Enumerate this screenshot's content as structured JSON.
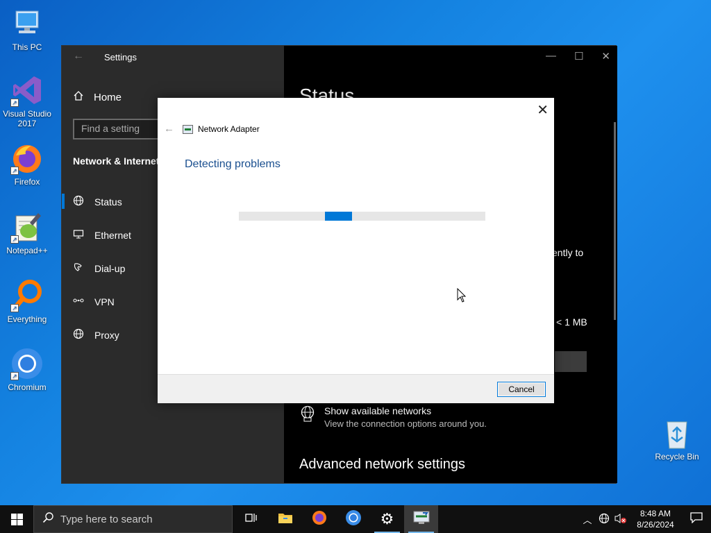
{
  "desktop": {
    "icons": [
      {
        "label": "This PC"
      },
      {
        "label": "Visual Studio 2017"
      },
      {
        "label": "Firefox"
      },
      {
        "label": "Notepad++"
      },
      {
        "label": "Everything"
      },
      {
        "label": "Chromium"
      },
      {
        "label": "Recycle Bin"
      }
    ]
  },
  "settings": {
    "title": "Settings",
    "home_label": "Home",
    "search_placeholder": "Find a setting",
    "section": "Network & Internet",
    "nav": [
      {
        "label": "Status",
        "icon": "globe-icon"
      },
      {
        "label": "Ethernet",
        "icon": "monitor-icon"
      },
      {
        "label": "Dial-up",
        "icon": "phone-icon"
      },
      {
        "label": "VPN",
        "icon": "vpn-icon"
      },
      {
        "label": "Proxy",
        "icon": "globe-icon"
      }
    ],
    "main": {
      "heading": "Status",
      "partial_text_1": "ently to",
      "partial_text_2": "< 1 MB",
      "show_networks_title": "Show available networks",
      "show_networks_desc": "View the connection options around you.",
      "advanced_heading": "Advanced network settings"
    }
  },
  "dialog": {
    "app_name": "Network Adapter",
    "heading": "Detecting problems",
    "cancel_label": "Cancel",
    "progress_segment_start": 0.35,
    "progress_segment_width": 0.11
  },
  "taskbar": {
    "search_placeholder": "Type here to search",
    "time": "8:48 AM",
    "date": "8/26/2024"
  },
  "colors": {
    "accent": "#0078d7",
    "dialog_heading": "#1a4f8f",
    "settings_sidebar": "#2b2b2b"
  }
}
